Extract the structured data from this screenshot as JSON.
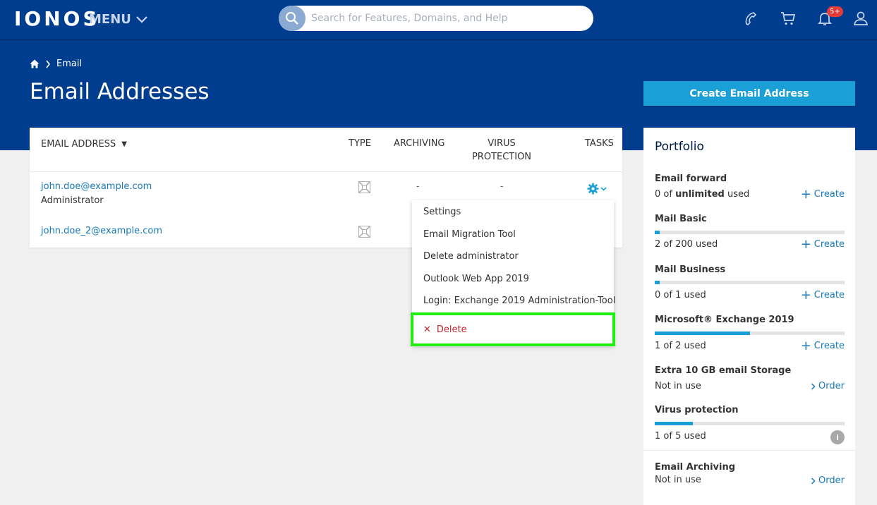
{
  "header": {
    "logo": "IONOS",
    "menu_label": "MENU",
    "search_placeholder": "Search for Features, Domains, and Help",
    "notification_badge": "5+"
  },
  "breadcrumb": {
    "current": "Email"
  },
  "page": {
    "title": "Email Addresses",
    "create_button": "Create Email Address"
  },
  "table": {
    "columns": {
      "email": "EMAIL ADDRESS",
      "type": "TYPE",
      "archiving": "ARCHIVING",
      "virus_line1": "VIRUS",
      "virus_line2": "PROTECTION",
      "tasks": "TASKS"
    },
    "rows": [
      {
        "email": "john.doe@example.com",
        "role": "Administrator",
        "archiving": "-",
        "virus": "-"
      },
      {
        "email": "john.doe_2@example.com",
        "role": ""
      }
    ]
  },
  "dropdown": {
    "items": [
      "Settings",
      "Email Migration Tool",
      "Delete administrator",
      "Outlook Web App 2019",
      "Login: Exchange 2019 Administration-Tool"
    ],
    "delete_label": "Delete"
  },
  "portfolio": {
    "title": "Portfolio",
    "items": [
      {
        "name": "Email forward",
        "used_prefix": "0 of ",
        "used_strong": "unlimited",
        "used_suffix": " used",
        "action": "Create"
      },
      {
        "name": "Mail Basic",
        "used": "2 of 200 used",
        "action": "Create",
        "progress": 0.01
      },
      {
        "name": "Mail Business",
        "used": "0 of 1 used",
        "action": "Create",
        "progress": 0.0
      },
      {
        "name": "Microsoft® Exchange 2019",
        "used": "1 of 2 used",
        "action": "Create",
        "progress": 0.5
      },
      {
        "name": "Extra 10 GB email Storage",
        "used": "Not in use",
        "action": "Order"
      },
      {
        "name": "Virus protection",
        "used": "1 of 5 used",
        "progress": 0.2
      },
      {
        "name": "Email Archiving",
        "used": "Not in use",
        "action": "Order"
      }
    ]
  },
  "colors": {
    "brand_blue": "#003d8f",
    "accent": "#1aa0d6",
    "link": "#1879b8",
    "delete_red": "#c4262e",
    "highlight_green": "#22ee11"
  }
}
